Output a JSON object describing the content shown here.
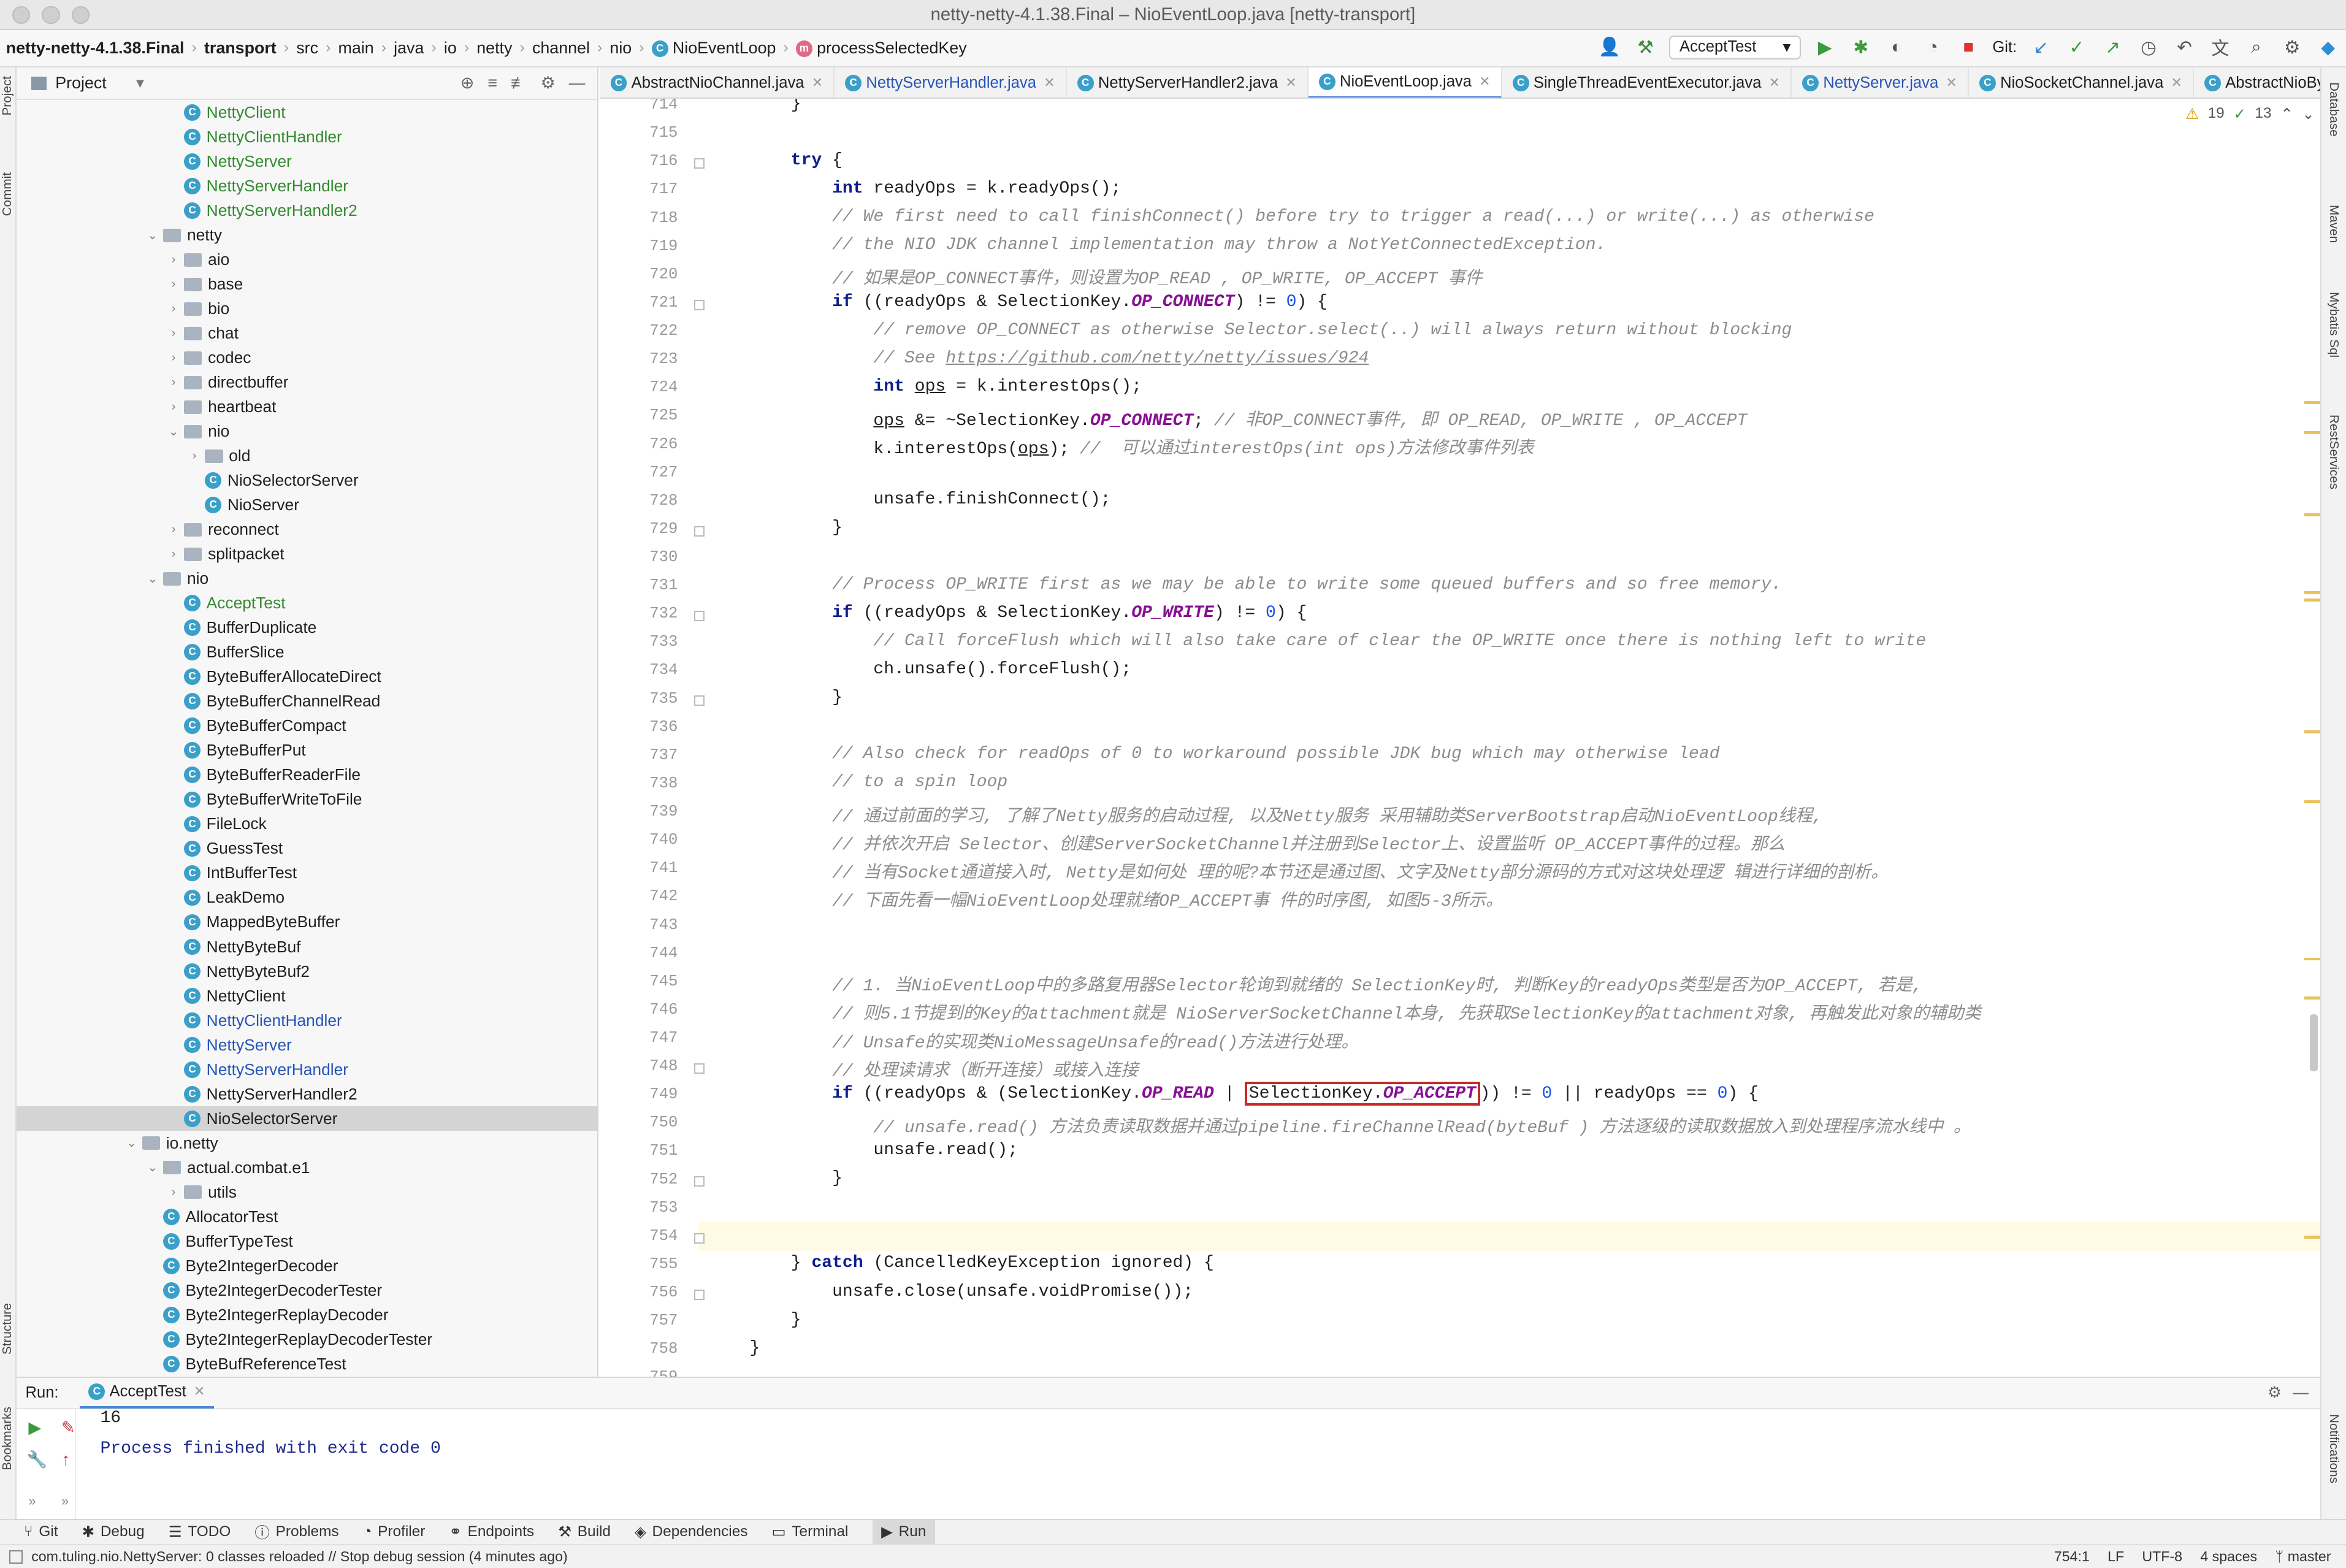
{
  "window": {
    "title": "netty-netty-4.1.38.Final – NioEventLoop.java [netty-transport]"
  },
  "breadcrumbs": [
    "netty-netty-4.1.38.Final",
    "transport",
    "src",
    "main",
    "java",
    "io",
    "netty",
    "channel",
    "nio",
    "NioEventLoop",
    "processSelectedKey"
  ],
  "toolbar": {
    "run_config": "AcceptTest",
    "git_label": "Git:"
  },
  "project": {
    "title": "Project",
    "tree": [
      {
        "label": "NettyClient",
        "depth": 3,
        "type": "class",
        "color": "g"
      },
      {
        "label": "NettyClientHandler",
        "depth": 3,
        "type": "class",
        "color": "g"
      },
      {
        "label": "NettyServer",
        "depth": 3,
        "type": "class",
        "color": "g"
      },
      {
        "label": "NettyServerHandler",
        "depth": 3,
        "type": "class",
        "color": "g"
      },
      {
        "label": "NettyServerHandler2",
        "depth": 3,
        "type": "class",
        "color": "g"
      },
      {
        "label": "netty",
        "depth": 2,
        "type": "folder-open"
      },
      {
        "label": "aio",
        "depth": 3,
        "type": "folder"
      },
      {
        "label": "base",
        "depth": 3,
        "type": "folder"
      },
      {
        "label": "bio",
        "depth": 3,
        "type": "folder"
      },
      {
        "label": "chat",
        "depth": 3,
        "type": "folder"
      },
      {
        "label": "codec",
        "depth": 3,
        "type": "folder"
      },
      {
        "label": "directbuffer",
        "depth": 3,
        "type": "folder"
      },
      {
        "label": "heartbeat",
        "depth": 3,
        "type": "folder"
      },
      {
        "label": "nio",
        "depth": 3,
        "type": "folder-open"
      },
      {
        "label": "old",
        "depth": 4,
        "type": "folder"
      },
      {
        "label": "NioSelectorServer",
        "depth": 4,
        "type": "class",
        "color": "k"
      },
      {
        "label": "NioServer",
        "depth": 4,
        "type": "class",
        "color": "k"
      },
      {
        "label": "reconnect",
        "depth": 3,
        "type": "folder"
      },
      {
        "label": "splitpacket",
        "depth": 3,
        "type": "folder"
      },
      {
        "label": "nio",
        "depth": 2,
        "type": "folder-open"
      },
      {
        "label": "AcceptTest",
        "depth": 3,
        "type": "class",
        "color": "g"
      },
      {
        "label": "BufferDuplicate",
        "depth": 3,
        "type": "class",
        "color": "k"
      },
      {
        "label": "BufferSlice",
        "depth": 3,
        "type": "class",
        "color": "k"
      },
      {
        "label": "ByteBufferAllocateDirect",
        "depth": 3,
        "type": "class",
        "color": "k"
      },
      {
        "label": "ByteBufferChannelRead",
        "depth": 3,
        "type": "class",
        "color": "k"
      },
      {
        "label": "ByteBufferCompact",
        "depth": 3,
        "type": "class",
        "color": "k"
      },
      {
        "label": "ByteBufferPut",
        "depth": 3,
        "type": "class",
        "color": "k"
      },
      {
        "label": "ByteBufferReaderFile",
        "depth": 3,
        "type": "class",
        "color": "k"
      },
      {
        "label": "ByteBufferWriteToFile",
        "depth": 3,
        "type": "class",
        "color": "k"
      },
      {
        "label": "FileLock",
        "depth": 3,
        "type": "class",
        "color": "k"
      },
      {
        "label": "GuessTest",
        "depth": 3,
        "type": "class",
        "color": "k"
      },
      {
        "label": "IntBufferTest",
        "depth": 3,
        "type": "class",
        "color": "k"
      },
      {
        "label": "LeakDemo",
        "depth": 3,
        "type": "class",
        "color": "k"
      },
      {
        "label": "MappedByteBuffer",
        "depth": 3,
        "type": "class",
        "color": "k"
      },
      {
        "label": "NettyByteBuf",
        "depth": 3,
        "type": "class",
        "color": "k"
      },
      {
        "label": "NettyByteBuf2",
        "depth": 3,
        "type": "class",
        "color": "k"
      },
      {
        "label": "NettyClient",
        "depth": 3,
        "type": "class",
        "color": "k"
      },
      {
        "label": "NettyClientHandler",
        "depth": 3,
        "type": "class",
        "color": "bl"
      },
      {
        "label": "NettyServer",
        "depth": 3,
        "type": "class",
        "color": "bl"
      },
      {
        "label": "NettyServerHandler",
        "depth": 3,
        "type": "class",
        "color": "bl"
      },
      {
        "label": "NettyServerHandler2",
        "depth": 3,
        "type": "class",
        "color": "k"
      },
      {
        "label": "NioSelectorServer",
        "depth": 3,
        "type": "class",
        "color": "k",
        "selected": true
      },
      {
        "label": "io.netty",
        "depth": 1,
        "type": "folder-open"
      },
      {
        "label": "actual.combat.e1",
        "depth": 2,
        "type": "folder-open"
      },
      {
        "label": "utils",
        "depth": 3,
        "type": "folder"
      },
      {
        "label": "AllocatorTest",
        "depth": 2,
        "type": "class",
        "color": "k"
      },
      {
        "label": "BufferTypeTest",
        "depth": 2,
        "type": "class",
        "color": "k"
      },
      {
        "label": "Byte2IntegerDecoder",
        "depth": 2,
        "type": "class",
        "color": "k"
      },
      {
        "label": "Byte2IntegerDecoderTester",
        "depth": 2,
        "type": "class",
        "color": "k"
      },
      {
        "label": "Byte2IntegerReplayDecoder",
        "depth": 2,
        "type": "class",
        "color": "k"
      },
      {
        "label": "Byte2IntegerReplayDecoderTester",
        "depth": 2,
        "type": "class",
        "color": "k"
      },
      {
        "label": "ByteBufReferenceTest",
        "depth": 2,
        "type": "class",
        "color": "k"
      }
    ]
  },
  "tabs": [
    {
      "label": "AbstractNioChannel.java",
      "color": "k"
    },
    {
      "label": "NettyServerHandler.java",
      "color": "bl"
    },
    {
      "label": "NettyServerHandler2.java",
      "color": "k"
    },
    {
      "label": "NioEventLoop.java",
      "color": "k",
      "active": true
    },
    {
      "label": "SingleThreadEventExecutor.java",
      "color": "k"
    },
    {
      "label": "NettyServer.java",
      "color": "bl"
    },
    {
      "label": "NioSocketChannel.java",
      "color": "k"
    },
    {
      "label": "AbstractNioByteCha",
      "color": "k"
    }
  ],
  "inspections": {
    "warnings": "19",
    "ok": "13"
  },
  "editor": {
    "lines": [
      {
        "n": "714",
        "html": "    <span>}</span>"
      },
      {
        "n": "715",
        "html": ""
      },
      {
        "n": "716",
        "html": "    <span class='kw'>try</span> {"
      },
      {
        "n": "717",
        "html": "        <span class='kw'>int</span> readyOps = k.readyOps();"
      },
      {
        "n": "718",
        "html": "        <span class='cm'>// We first need to call finishConnect() before try to trigger a read(...) or write(...) as otherwise</span>"
      },
      {
        "n": "719",
        "html": "        <span class='cm'>// the NIO JDK channel implementation may throw a NotYetConnectedException.</span>"
      },
      {
        "n": "720",
        "html": "        <span class='cm'>// 如果是OP_CONNECT事件，则设置为OP_READ , OP_WRITE, OP_ACCEPT 事件</span>"
      },
      {
        "n": "721",
        "html": "        <span class='kw'>if</span> ((readyOps &amp; SelectionKey.<span class='fld'>OP_CONNECT</span>) != <span class='num'>0</span>) {"
      },
      {
        "n": "722",
        "html": "            <span class='cm'>// remove OP_CONNECT as otherwise Selector.select(..) will always return without blocking</span>"
      },
      {
        "n": "723",
        "html": "            <span class='cm'>// See <u>https://github.com/netty/netty/issues/924</u></span>"
      },
      {
        "n": "724",
        "html": "            <span class='kw'>int</span> <u>ops</u> = k.interestOps();"
      },
      {
        "n": "725",
        "html": "            <u>ops</u> &amp;= ~SelectionKey.<span class='fld'>OP_CONNECT</span>; <span class='cm'>// 非OP_CONNECT事件, 即 OP_READ, OP_WRITE , OP_ACCEPT</span>"
      },
      {
        "n": "726",
        "html": "            k.interestOps(<u>ops</u>); <span class='cm'>//  可以通过interestOps(int ops)方法修改事件列表</span>"
      },
      {
        "n": "727",
        "html": ""
      },
      {
        "n": "728",
        "html": "            unsafe.finishConnect();"
      },
      {
        "n": "729",
        "html": "        }"
      },
      {
        "n": "730",
        "html": ""
      },
      {
        "n": "731",
        "html": "        <span class='cm'>// Process OP_WRITE first as we may be able to write some queued buffers and so free memory.</span>"
      },
      {
        "n": "732",
        "html": "        <span class='kw'>if</span> ((readyOps &amp; SelectionKey.<span class='fld'>OP_WRITE</span>) != <span class='num'>0</span>) {"
      },
      {
        "n": "733",
        "html": "            <span class='cm'>// Call forceFlush which will also take care of clear the OP_WRITE once there is nothing left to write</span>"
      },
      {
        "n": "734",
        "html": "            ch.unsafe().forceFlush();"
      },
      {
        "n": "735",
        "html": "        }"
      },
      {
        "n": "736",
        "html": ""
      },
      {
        "n": "737",
        "html": "        <span class='cm'>// Also check for readOps of 0 to workaround possible JDK bug which may otherwise lead</span>"
      },
      {
        "n": "738",
        "html": "        <span class='cm'>// to a spin loop</span>"
      },
      {
        "n": "739",
        "html": "        <span class='cm'>// 通过前面的学习, 了解了Netty服务的启动过程, 以及Netty服务 采用辅助类ServerBootstrap启动NioEventLoop线程,</span>"
      },
      {
        "n": "740",
        "html": "        <span class='cm'>// 并依次开启 Selector、创建ServerSocketChannel并注册到Selector上、设置监听 OP_ACCEPT事件的过程。那么</span>"
      },
      {
        "n": "741",
        "html": "        <span class='cm'>// 当有Socket通道接入时, Netty是如何处 理的呢?本节还是通过图、文字及Netty部分源码的方式对这块处理逻 辑进行详细的剖析。</span>"
      },
      {
        "n": "742",
        "html": "        <span class='cm'>// 下面先看一幅NioEventLoop处理就绪OP_ACCEPT事 件的时序图, 如图5-3所示。</span>"
      },
      {
        "n": "743",
        "html": ""
      },
      {
        "n": "744",
        "html": ""
      },
      {
        "n": "745",
        "html": "        <span class='cm'>// 1. 当NioEventLoop中的多路复用器Selector轮询到就绪的 SelectionKey时, 判断Key的readyOps类型是否为OP_ACCEPT, 若是,</span>"
      },
      {
        "n": "746",
        "html": "        <span class='cm'>// 则5.1节提到的Key的attachment就是 NioServerSocketChannel本身, 先获取SelectionKey的attachment对象, 再触发此对象的辅助类</span>"
      },
      {
        "n": "747",
        "html": "        <span class='cm'>// Unsafe的实现类NioMessageUnsafe的read()方法进行处理。</span>"
      },
      {
        "n": "748",
        "html": "        <span class='cm'>// 处理读请求（断开连接）或接入连接</span>"
      },
      {
        "n": "749",
        "html": "        <span class='kw'>if</span> ((readyOps &amp; (SelectionKey.<span class='fld'>OP_READ</span> | <span class='hl-box'>SelectionKey.<span class='fld'>OP_ACCEPT</span></span>)) != <span class='num'>0</span> || readyOps == <span class='num'>0</span>) {"
      },
      {
        "n": "750",
        "html": "            <span class='cm'>// unsafe.read() 方法负责读取数据并通过pipeline.fireChannelRead(byteBuf ) 方法逐级的读取数据放入到处理程序流水线中 。</span>"
      },
      {
        "n": "751",
        "html": "            unsafe.read();"
      },
      {
        "n": "752",
        "html": "        }"
      },
      {
        "n": "753",
        "html": ""
      },
      {
        "n": "754",
        "html": "",
        "current": true
      },
      {
        "n": "755",
        "html": "    } <span class='kw'>catch</span> (CancelledKeyException ignored) {"
      },
      {
        "n": "756",
        "html": "        unsafe.close(unsafe.voidPromise());"
      },
      {
        "n": "757",
        "html": "    }"
      },
      {
        "n": "758",
        "html": "}"
      },
      {
        "n": "759",
        "html": ""
      }
    ]
  },
  "run": {
    "label": "Run:",
    "tab": "AcceptTest",
    "output": [
      "16",
      "",
      "Process finished with exit code 0"
    ]
  },
  "bottom_tools": [
    "Git",
    "Debug",
    "TODO",
    "Problems",
    "Profiler",
    "Endpoints",
    "Build",
    "Dependencies",
    "Terminal",
    "Run"
  ],
  "status": {
    "message": "com.tuling.nio.NettyServer: 0 classes reloaded // Stop debug session (4 minutes ago)",
    "position": "754:1",
    "line_sep": "LF",
    "encoding": "UTF-8",
    "indent": "4 spaces",
    "branch": "master"
  },
  "side_labels": {
    "left": [
      "Project",
      "Commit",
      "Structure",
      "Bookmarks"
    ],
    "right": [
      "Database",
      "Maven",
      "Mybatis Sql",
      "RestServices",
      "Notifications"
    ]
  }
}
